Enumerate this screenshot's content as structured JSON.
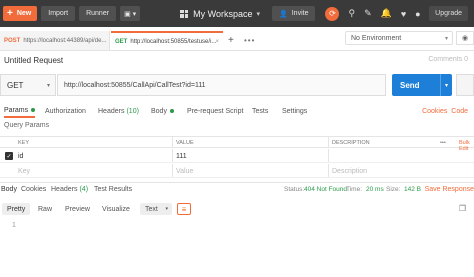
{
  "topbar": {
    "new_label": "New",
    "import_label": "Import",
    "runner_label": "Runner",
    "workspace_label": "My Workspace",
    "invite_label": "Invite",
    "upgrade_label": "Upgrade",
    "icons": [
      "sync-icon",
      "satellite-icon",
      "wrench-icon",
      "bell-icon",
      "heart-icon",
      "user-icon"
    ]
  },
  "tabs": [
    {
      "method": "POST",
      "url": "https://localhost:44389/api/de...",
      "method_color": "#f26b3a"
    },
    {
      "method": "GET",
      "url": "http://localhost:50855/testuse/i...",
      "method_color": "#2a9a4a",
      "active": true
    }
  ],
  "environment": {
    "selected": "No Environment"
  },
  "request": {
    "title": "Untitled Request",
    "comments_label": "Comments 0",
    "method": "GET",
    "url": "http://localhost:50855/CallApi/CallTest?id=111",
    "send_label": "Send"
  },
  "request_tabs": {
    "params": "Params",
    "authorization": "Authorization",
    "headers": "Headers",
    "headers_count": "(10)",
    "body": "Body",
    "pre_request": "Pre-request Script",
    "tests": "Tests",
    "settings": "Settings",
    "cookies": "Cookies",
    "code": "Code"
  },
  "params": {
    "section_label": "Query Params",
    "columns": {
      "key": "KEY",
      "value": "VALUE",
      "description": "DESCRIPTION",
      "bulk": "Bulk Edit"
    },
    "rows": [
      {
        "key": "id",
        "value": "111",
        "description": "",
        "checked": true
      }
    ],
    "placeholder": {
      "key": "Key",
      "value": "Value",
      "description": "Description"
    }
  },
  "response": {
    "tabs": {
      "body": "Body",
      "cookies": "Cookies",
      "headers": "Headers",
      "headers_count": "(4)",
      "test_results": "Test Results"
    },
    "status_label": "Status:",
    "status_value": "404 Not Found",
    "time_label": "Time:",
    "time_value": "20 ms",
    "size_label": "Size:",
    "size_value": "142 B",
    "save_label": "Save Response",
    "views": {
      "pretty": "Pretty",
      "raw": "Raw",
      "preview": "Preview",
      "visualize": "Visualize"
    },
    "format": "Text",
    "line_number": "1"
  }
}
